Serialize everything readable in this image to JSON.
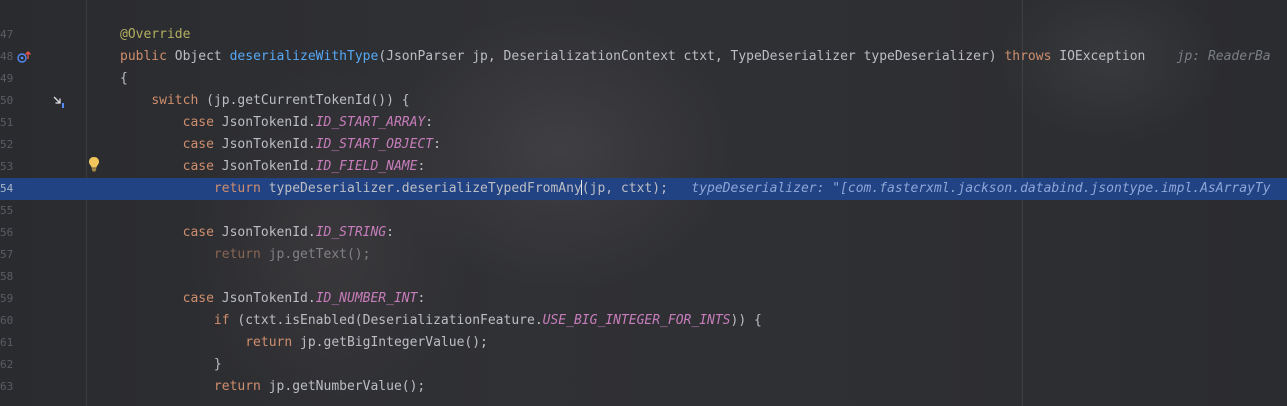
{
  "editor": {
    "line_numbers": [
      "47",
      "48",
      "49",
      "50",
      "51",
      "52",
      "53",
      "54",
      "55",
      "56",
      "57",
      "58",
      "59",
      "60",
      "61",
      "62",
      "63"
    ],
    "lines": [
      {
        "indent": "",
        "parts": [
          {
            "t": "@Override",
            "c": "ann"
          }
        ]
      },
      {
        "indent": "",
        "parts": [
          {
            "t": "public ",
            "c": "kw"
          },
          {
            "t": "Object ",
            "c": ""
          },
          {
            "t": "deserializeWithType",
            "c": "fn"
          },
          {
            "t": "(JsonParser jp, DeserializationContext ctxt, TypeDeserializer typeDeserializer) ",
            "c": ""
          },
          {
            "t": "throws ",
            "c": "kw"
          },
          {
            "t": "IOException",
            "c": ""
          },
          {
            "t": "    jp: ReaderBa",
            "c": "hint"
          }
        ]
      },
      {
        "indent": "",
        "parts": [
          {
            "t": "{",
            "c": ""
          }
        ]
      },
      {
        "indent": "    ",
        "parts": [
          {
            "t": "switch ",
            "c": "kw"
          },
          {
            "t": "(jp.getCurrentTokenId()) {",
            "c": ""
          }
        ]
      },
      {
        "indent": "        ",
        "parts": [
          {
            "t": "case ",
            "c": "kw"
          },
          {
            "t": "JsonTokenId.",
            "c": ""
          },
          {
            "t": "ID_START_ARRAY",
            "c": "const"
          },
          {
            "t": ":",
            "c": ""
          }
        ]
      },
      {
        "indent": "        ",
        "parts": [
          {
            "t": "case ",
            "c": "kw"
          },
          {
            "t": "JsonTokenId.",
            "c": ""
          },
          {
            "t": "ID_START_OBJECT",
            "c": "const"
          },
          {
            "t": ":",
            "c": ""
          }
        ]
      },
      {
        "indent": "        ",
        "parts": [
          {
            "t": "case ",
            "c": "kw"
          },
          {
            "t": "JsonTokenId.",
            "c": ""
          },
          {
            "t": "ID_FIELD_NAME",
            "c": "const"
          },
          {
            "t": ":",
            "c": ""
          }
        ]
      },
      {
        "indent": "            ",
        "hl": true,
        "parts": [
          {
            "t": "return ",
            "c": "kw"
          },
          {
            "t": "typeDeserializer.deserializeTypedFromAny",
            "c": ""
          },
          {
            "t": "|CARET|",
            "c": "caret"
          },
          {
            "t": "(jp, ctxt);",
            "c": ""
          },
          {
            "t": "   typeDeserializer: \"[com.fasterxml.jackson.databind.jsontype.impl.AsArrayTy",
            "c": "hint"
          }
        ]
      },
      {
        "indent": "",
        "parts": []
      },
      {
        "indent": "        ",
        "parts": [
          {
            "t": "case ",
            "c": "kw"
          },
          {
            "t": "JsonTokenId.",
            "c": ""
          },
          {
            "t": "ID_STRING",
            "c": "const"
          },
          {
            "t": ":",
            "c": ""
          }
        ]
      },
      {
        "indent": "            ",
        "dim": true,
        "parts": [
          {
            "t": "return ",
            "c": "kw"
          },
          {
            "t": "jp.getText();",
            "c": ""
          }
        ]
      },
      {
        "indent": "",
        "parts": []
      },
      {
        "indent": "        ",
        "parts": [
          {
            "t": "case ",
            "c": "kw"
          },
          {
            "t": "JsonTokenId.",
            "c": ""
          },
          {
            "t": "ID_NUMBER_INT",
            "c": "const"
          },
          {
            "t": ":",
            "c": ""
          }
        ]
      },
      {
        "indent": "            ",
        "parts": [
          {
            "t": "if ",
            "c": "kw"
          },
          {
            "t": "(ctxt.isEnabled(DeserializationFeature.",
            "c": ""
          },
          {
            "t": "USE_BIG_INTEGER_FOR_INTS",
            "c": "const"
          },
          {
            "t": ")) {",
            "c": ""
          }
        ]
      },
      {
        "indent": "                ",
        "parts": [
          {
            "t": "return ",
            "c": "kw"
          },
          {
            "t": "jp.getBigIntegerValue();",
            "c": ""
          }
        ]
      },
      {
        "indent": "            ",
        "parts": [
          {
            "t": "}",
            "c": ""
          }
        ]
      },
      {
        "indent": "            ",
        "parts": [
          {
            "t": "return ",
            "c": "kw"
          },
          {
            "t": "jp.getNumberValue();",
            "c": ""
          }
        ]
      }
    ]
  },
  "gutter_icons": {
    "override_icon": "override-up-arrow-icon",
    "step_icon": "debugger-step-icon",
    "bulb_icon": "lightbulb-icon"
  },
  "colors": {
    "background": "#2b2c30",
    "selection": "#214283",
    "keyword": "#cf8e6d",
    "method_decl": "#56a8f5",
    "constant": "#c77dbb",
    "annotation": "#b3ae60",
    "inline_hint": "#7a7e85"
  }
}
